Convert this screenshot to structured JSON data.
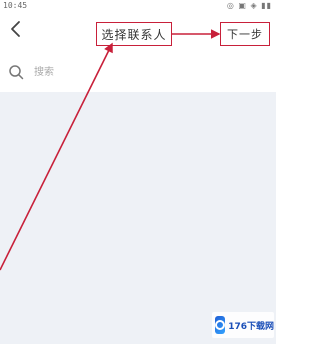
{
  "status_bar": {
    "time": "10:45",
    "signal": "?",
    "icons": "◎ ▣ ◈ ▮▮"
  },
  "header": {
    "title": "选择联系人",
    "next_label": "下一步"
  },
  "search": {
    "placeholder": "搜索"
  },
  "watermark": {
    "text": "176下载网"
  },
  "colors": {
    "annotation": "#c8203a",
    "list_background": "#eef1f6"
  }
}
